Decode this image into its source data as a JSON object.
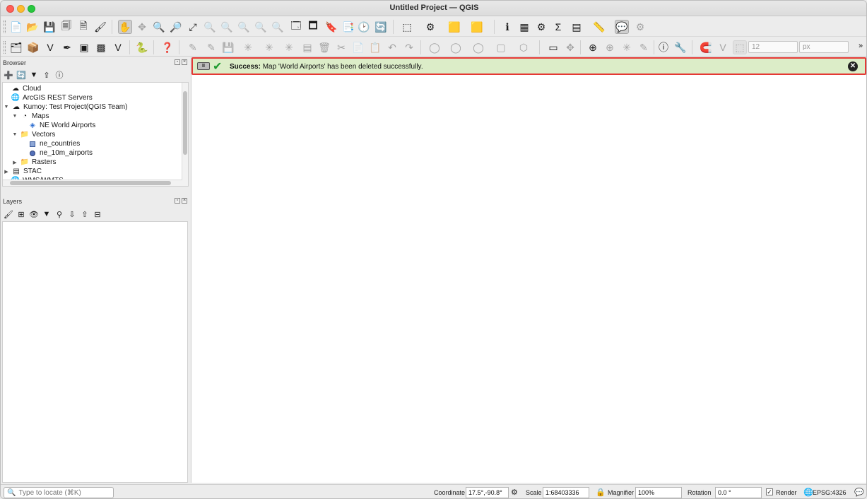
{
  "window": {
    "title": "Untitled Project — QGIS"
  },
  "toolbar": {
    "symbology_size_value": "12",
    "symbology_unit": "px",
    "overflow": "»"
  },
  "browser": {
    "title": "Browser",
    "items": [
      {
        "label": "Cloud",
        "icon": "cloud-icon"
      },
      {
        "label": "ArcGIS REST Servers",
        "icon": "globe-icon"
      },
      {
        "label": "Kumoy: Test Project(QGIS Team)",
        "icon": "cloud-icon"
      },
      {
        "label": "Maps",
        "icon": "map-icon"
      },
      {
        "label": "NE World Airports",
        "icon": "layers-icon"
      },
      {
        "label": "Vectors",
        "icon": "folder-icon"
      },
      {
        "label": "ne_countries",
        "icon": "polygon-layer-icon"
      },
      {
        "label": "ne_10m_airports",
        "icon": "point-layer-icon"
      },
      {
        "label": "Rasters",
        "icon": "folder-icon"
      },
      {
        "label": "STAC",
        "icon": "stac-icon"
      },
      {
        "label": "WMS/WMTS",
        "icon": "globe-icon"
      }
    ]
  },
  "layers": {
    "title": "Layers"
  },
  "message": {
    "label": "Success:",
    "text": "Map 'World Airports' has been deleted successfully.",
    "pause_label": "II",
    "close_glyph": "✕"
  },
  "status": {
    "locate_placeholder": "Type to locate (⌘K)",
    "coordinate_label": "Coordinate",
    "coordinate_value": "17.5°,-90.8°",
    "scale_label": "Scale",
    "scale_value": "1:68403336",
    "magnifier_label": "Magnifier",
    "magnifier_value": "100%",
    "rotation_label": "Rotation",
    "rotation_value": "0.0 °",
    "render_label": "Render",
    "render_checked": "✓",
    "crs_label": "EPSG:4326"
  },
  "colors": {
    "success_bg": "#dcedc8",
    "highlight_border": "#e53935",
    "check": "#1e9b2f"
  }
}
